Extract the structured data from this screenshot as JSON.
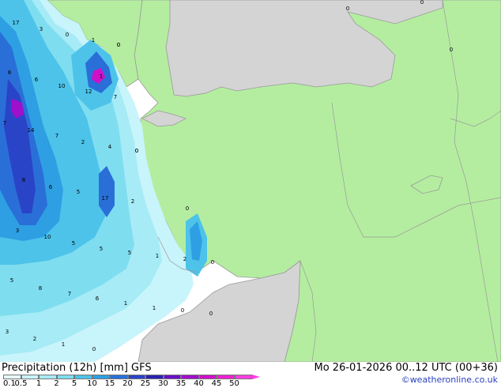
{
  "title": "Precipitation (12h) [mm] GFS",
  "valid_time": "Mo 26-01-2026 00..12 UTC (00+36)",
  "credit": "©weatheronline.co.uk",
  "colors": {
    "land": "#b4eda0",
    "uncovered_land": "#d4d4d4",
    "sea_outside": "#ffffff",
    "borders": "#9a9a9a",
    "credit": "#2a3fbf"
  },
  "legend": {
    "labels": [
      "0.1",
      "0.5",
      "1",
      "2",
      "5",
      "10",
      "15",
      "20",
      "25",
      "30",
      "35",
      "40",
      "45",
      "50"
    ],
    "colors": [
      "#e8fbff",
      "#c8f4fb",
      "#a6ebf6",
      "#7fddf0",
      "#4dc3ea",
      "#2e9fe3",
      "#2a6fd8",
      "#2a44c8",
      "#2a22b0",
      "#6a10c8",
      "#a010cc",
      "#d010c8",
      "#f020d0",
      "#ff40e0"
    ]
  },
  "map_values": [
    {
      "text": "17"
    },
    {
      "text": "3"
    },
    {
      "text": "0"
    },
    {
      "text": "1"
    },
    {
      "text": "0"
    },
    {
      "text": "8"
    },
    {
      "text": "6"
    },
    {
      "text": "10"
    },
    {
      "text": "1"
    },
    {
      "text": "12"
    },
    {
      "text": "7"
    },
    {
      "text": "7"
    },
    {
      "text": "14"
    },
    {
      "text": "7"
    },
    {
      "text": "2"
    },
    {
      "text": "4"
    },
    {
      "text": "0"
    },
    {
      "text": "0"
    },
    {
      "text": "8"
    },
    {
      "text": "6"
    },
    {
      "text": "5"
    },
    {
      "text": "17"
    },
    {
      "text": "2"
    },
    {
      "text": "3"
    },
    {
      "text": "10"
    },
    {
      "text": "5"
    },
    {
      "text": "5"
    },
    {
      "text": "5"
    },
    {
      "text": "1"
    },
    {
      "text": "2"
    },
    {
      "text": "0"
    },
    {
      "text": "0"
    },
    {
      "text": "5"
    },
    {
      "text": "8"
    },
    {
      "text": "7"
    },
    {
      "text": "6"
    },
    {
      "text": "1"
    },
    {
      "text": "1"
    },
    {
      "text": "0"
    },
    {
      "text": "0"
    },
    {
      "text": "3"
    },
    {
      "text": "2"
    },
    {
      "text": "1"
    },
    {
      "text": "0"
    },
    {
      "text": "0"
    },
    {
      "text": "0"
    },
    {
      "text": "0"
    },
    {
      "text": "0"
    }
  ]
}
